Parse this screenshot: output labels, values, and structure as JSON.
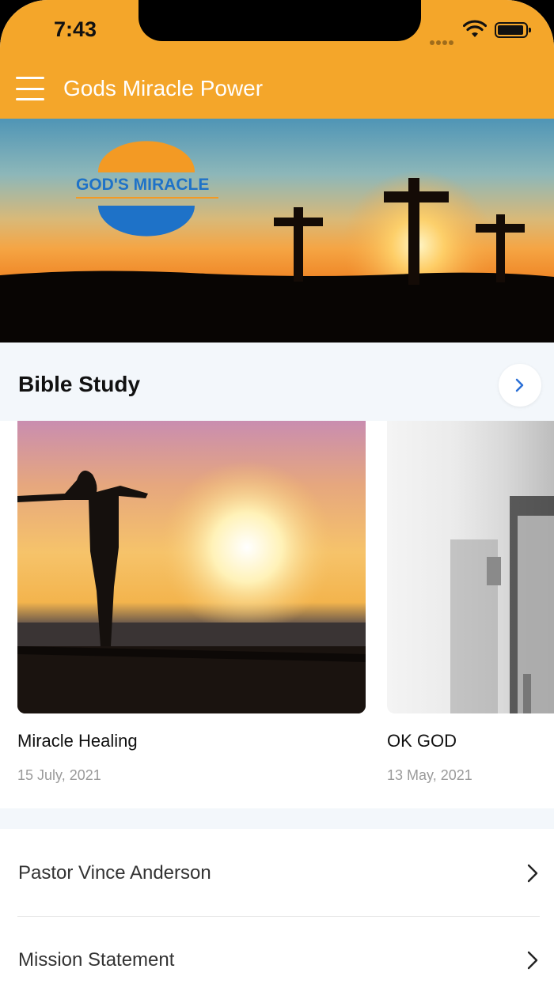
{
  "status_bar": {
    "time": "7:43"
  },
  "app_bar": {
    "title": "Gods Miracle Power"
  },
  "hero": {
    "logo_text": "GOD'S MIRACLE"
  },
  "section": {
    "title": "Bible Study"
  },
  "cards": [
    {
      "title": "Miracle Healing",
      "date": "15 July, 2021"
    },
    {
      "title": "OK GOD",
      "date": "13 May, 2021"
    }
  ],
  "list": [
    {
      "label": "Pastor Vince Anderson"
    },
    {
      "label": "Mission Statement"
    }
  ],
  "colors": {
    "accent": "#F4A62A",
    "section_bg": "#F3F7FB",
    "link_blue": "#2b6fd6"
  }
}
